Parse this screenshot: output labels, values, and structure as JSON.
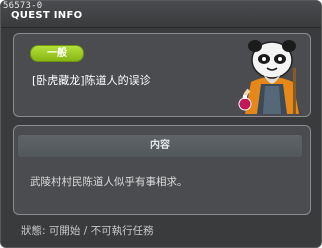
{
  "window": {
    "id_label": "56573-0",
    "title": "QUEST INFO"
  },
  "quest": {
    "category": "一般",
    "name": "[卧虎藏龙]陈道人的误诊",
    "npc_icon": "panda-mask-npc-icon"
  },
  "content": {
    "header": "内容",
    "text": "武陵村村民陈道人似乎有事相求。"
  },
  "status": {
    "text": "狀態: 可開始 / 不可執行任務"
  },
  "colors": {
    "window_bg": "#3a3b3d",
    "panel_bg": "#4a4c4f",
    "badge_green": "#9acb24"
  }
}
